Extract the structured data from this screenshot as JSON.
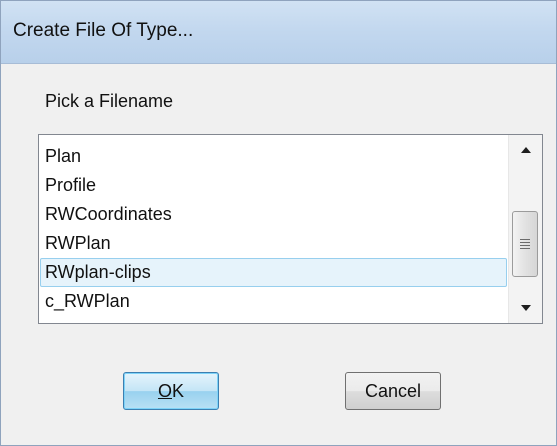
{
  "dialog": {
    "title": "Create File Of Type...",
    "prompt": "Pick a Filename"
  },
  "filelist": {
    "items": [
      "Plan",
      "Profile",
      "RWCoordinates",
      "RWPlan",
      "RWplan-clips",
      "c_RWPlan"
    ],
    "selected_index": 4,
    "scroll_position": 0.5
  },
  "buttons": {
    "ok_label": "OK",
    "ok_mnemonic": "O",
    "ok_rest": "K",
    "cancel_label": "Cancel"
  },
  "icons": {
    "scroll_up": "triangle-up-icon",
    "scroll_down": "triangle-down-icon",
    "thumb_grip": "grip-lines-icon"
  },
  "colors": {
    "titlebar": "#c3d8ef",
    "selection_bg": "#e6f3fb",
    "selection_border": "#97cfee",
    "default_button_border": "#3c7fb1"
  }
}
